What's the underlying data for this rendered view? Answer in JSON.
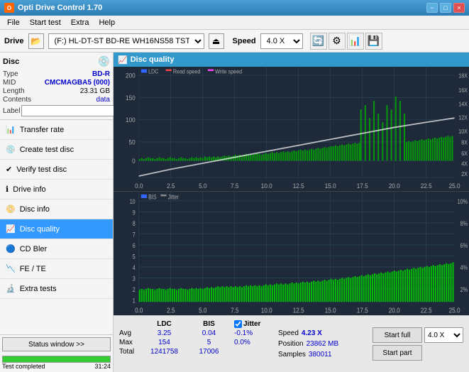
{
  "titlebar": {
    "title": "Opti Drive Control 1.70",
    "min_label": "−",
    "max_label": "□",
    "close_label": "×"
  },
  "menu": {
    "items": [
      "File",
      "Start test",
      "Extra",
      "Help"
    ]
  },
  "drive_bar": {
    "label": "Drive",
    "drive_value": "(F:)  HL-DT-ST BD-RE  WH16NS58 TST4",
    "speed_label": "Speed",
    "speed_value": "4.0 X"
  },
  "disc": {
    "title": "Disc",
    "type_label": "Type",
    "type_val": "BD-R",
    "mid_label": "MID",
    "mid_val": "CMCMAGBA5 (000)",
    "length_label": "Length",
    "length_val": "23.31 GB",
    "contents_label": "Contents",
    "contents_val": "data",
    "label_label": "Label"
  },
  "nav": {
    "items": [
      {
        "id": "transfer-rate",
        "label": "Transfer rate",
        "icon": "📊"
      },
      {
        "id": "create-test-disc",
        "label": "Create test disc",
        "icon": "💿"
      },
      {
        "id": "verify-test-disc",
        "label": "Verify test disc",
        "icon": "✔"
      },
      {
        "id": "drive-info",
        "label": "Drive info",
        "icon": "ℹ"
      },
      {
        "id": "disc-info",
        "label": "Disc info",
        "icon": "📀"
      },
      {
        "id": "disc-quality",
        "label": "Disc quality",
        "icon": "📈",
        "active": true
      },
      {
        "id": "cd-bler",
        "label": "CD Bler",
        "icon": "🔵"
      },
      {
        "id": "fe-te",
        "label": "FE / TE",
        "icon": "📉"
      },
      {
        "id": "extra-tests",
        "label": "Extra tests",
        "icon": "🔬"
      }
    ]
  },
  "status": {
    "window_btn": "Status window >>",
    "progress_pct": 100,
    "status_text": "Test completed",
    "time_text": "31:24"
  },
  "disc_quality": {
    "header": "Disc quality",
    "legend": {
      "ldc": "LDC",
      "read_speed": "Read speed",
      "write_speed": "Write speed",
      "bis": "BIS",
      "jitter": "Jitter"
    }
  },
  "stats": {
    "col_headers": [
      "LDC",
      "BIS",
      "",
      "Jitter"
    ],
    "rows": [
      {
        "label": "Avg",
        "ldc": "3.25",
        "bis": "0.04",
        "jitter": "-0.1%"
      },
      {
        "label": "Max",
        "ldc": "154",
        "bis": "5",
        "jitter": "0.0%"
      },
      {
        "label": "Total",
        "ldc": "1241758",
        "bis": "17006",
        "jitter": ""
      }
    ],
    "speed_label": "Speed",
    "speed_val": "4.23 X",
    "speed_select": "4.0 X",
    "position_label": "Position",
    "position_val": "23862 MB",
    "samples_label": "Samples",
    "samples_val": "380011",
    "start_full_btn": "Start full",
    "start_part_btn": "Start part"
  },
  "chart_top": {
    "y_max": 200,
    "y_labels": [
      200,
      150,
      100,
      50,
      0
    ],
    "x_labels": [
      0,
      2.5,
      5.0,
      7.5,
      10.0,
      12.5,
      15.0,
      17.5,
      20.0,
      22.5,
      25.0
    ],
    "right_labels": [
      "18X",
      "16X",
      "14X",
      "12X",
      "10X",
      "8X",
      "6X",
      "4X",
      "2X"
    ]
  },
  "chart_bottom": {
    "y_max": 10,
    "y_labels": [
      10,
      9,
      8,
      7,
      6,
      5,
      4,
      3,
      2,
      1
    ],
    "x_labels": [
      0,
      2.5,
      5.0,
      7.5,
      10.0,
      12.5,
      15.0,
      17.5,
      20.0,
      22.5,
      25.0
    ],
    "right_labels": [
      "10%",
      "8%",
      "6%",
      "4%",
      "2%"
    ]
  }
}
